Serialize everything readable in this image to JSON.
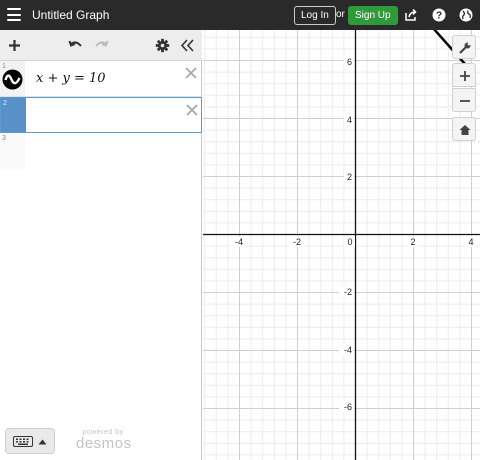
{
  "header": {
    "title": "Untitled Graph",
    "login_label": "Log In",
    "or_label": "or",
    "signup_label": "Sign Up"
  },
  "expressions": [
    {
      "number": "1",
      "latex": "x + y = 10"
    },
    {
      "number": "2",
      "latex": ""
    },
    {
      "number": "3",
      "latex": ""
    }
  ],
  "branding": {
    "powered_by": "powered by",
    "name": "desmos"
  },
  "graph": {
    "x_ticks": [
      "-4",
      "-2",
      "0",
      "2",
      "4"
    ],
    "y_ticks": [
      "6",
      "4",
      "2",
      "-2",
      "-4",
      "-6"
    ]
  },
  "colors": {
    "topbar": "#2a2a2a",
    "signup": "#2f9a3a",
    "selection": "#5a90c8",
    "curve": "#000000"
  }
}
